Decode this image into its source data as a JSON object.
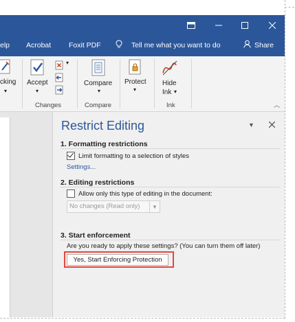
{
  "titlebar": {
    "controls": [
      "ribbon-display-options",
      "minimize",
      "maximize",
      "close"
    ]
  },
  "menu": {
    "items": [
      "elp",
      "Acrobat",
      "Foxit PDF",
      "Tell me what you want to do",
      "Share"
    ]
  },
  "ribbon": {
    "tracking_label_partial": "cking",
    "accept_label": "Accept",
    "compare_label": "Compare",
    "protect_label": "Protect",
    "hide_ink_label_line1": "Hide",
    "hide_ink_label_line2": "Ink",
    "groups": {
      "changes": "Changes",
      "compare": "Compare",
      "ink": "Ink"
    }
  },
  "pane": {
    "title": "Restrict Editing",
    "section1": {
      "heading": "1. Formatting restrictions",
      "checkbox_label": "Limit formatting to a selection of styles",
      "checkbox_checked": true,
      "settings_link": "Settings..."
    },
    "section2": {
      "heading": "2. Editing restrictions",
      "checkbox_label": "Allow only this type of editing in the document:",
      "checkbox_checked": false,
      "dropdown_value": "No changes (Read only)"
    },
    "section3": {
      "heading": "3. Start enforcement",
      "question": "Are you ready to apply these settings? (You can turn them off later)",
      "button_label": "Yes, Start Enforcing Protection",
      "highlight_color": "#e8443b"
    }
  },
  "colors": {
    "accent": "#2b579a",
    "pane_bg": "#f0f0f0",
    "ribbon_bg": "#f3f3f3"
  }
}
